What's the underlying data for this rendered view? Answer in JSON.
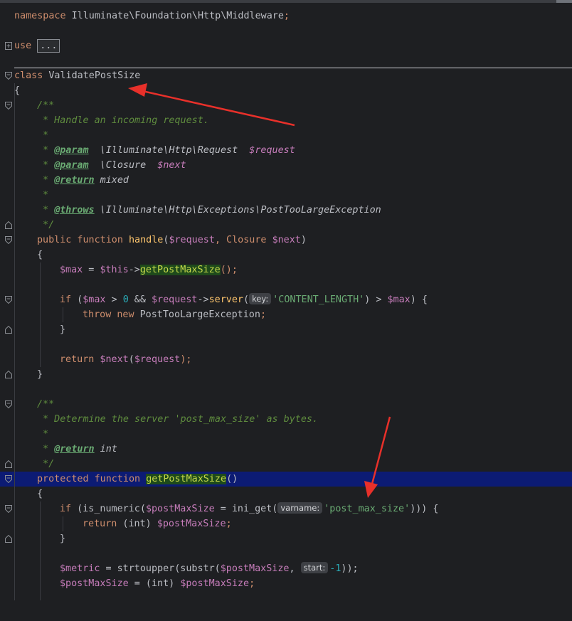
{
  "editor": {
    "lines": {
      "namespace_kw": "namespace",
      "namespace_name": " Illuminate\\Foundation\\Http\\Middleware",
      "namespace_semi": ";",
      "use_kw": "use",
      "use_folded": "...",
      "class_kw": "class",
      "class_name": " ValidatePostSize",
      "brace_open": "{",
      "doc1_open": "/**",
      "doc1_line1": " * Handle an incoming request.",
      "doc1_star": " *",
      "doc1_param1_star": " * ",
      "doc1_param1_tag": "@param",
      "doc1_param1_type": "  \\Illuminate\\Http\\Request  ",
      "doc1_param1_var": "$request",
      "doc1_param2_tag": "@param",
      "doc1_param2_type": "  \\Closure  ",
      "doc1_param2_var": "$next",
      "doc1_return_tag": "@return",
      "doc1_return_type": " mixed",
      "doc1_throws_tag": "@throws",
      "doc1_throws_type": " \\Illuminate\\Http\\Exceptions\\PostTooLargeException",
      "doc1_close": " */",
      "handle_public": "public",
      "handle_function": " function ",
      "handle_name": "handle",
      "handle_paren_open": "(",
      "handle_req": "$request",
      "handle_comma": ", Closure ",
      "handle_next": "$next",
      "handle_paren_close": ")",
      "body_brace_open": "{",
      "max_var": "$max",
      "max_eq": " = ",
      "this_var": "$this",
      "arrow_op": "->",
      "getpms_call": "getPostMaxSize",
      "call_end": "();",
      "if_kw": "if",
      "if_open": " (",
      "if_max": "$max",
      "if_gt": " > ",
      "if_zero": "0",
      "if_and": " && ",
      "if_req": "$request",
      "if_arrow": "->",
      "if_server": "server",
      "if_paren": "(",
      "hint_key": "key:",
      "if_str": "'CONTENT_LENGTH'",
      "if_close1": ") > ",
      "if_max2": "$max",
      "if_close2": ") {",
      "throw_kw": "throw",
      "new_kw": " new",
      "throw_cls": " PostTooLargeException",
      "throw_semi": ";",
      "if_brace_close": "}",
      "return_kw": "return",
      "return_next": " $next",
      "return_paren": "(",
      "return_req": "$request",
      "return_end": ");",
      "body_brace_close": "}",
      "doc2_open": "/**",
      "doc2_line1": " * Determine the server 'post_max_size' as bytes.",
      "doc2_star": " *",
      "doc2_return_tag": "@return",
      "doc2_return_type": " int",
      "doc2_close": " */",
      "gpms_protected": "protected",
      "gpms_function": " function ",
      "gpms_name": "getPostMaxSize",
      "gpms_parens": "()",
      "gpms_brace_open": "{",
      "if2_kw": "if",
      "if2_open": " (is_numeric(",
      "if2_var": "$postMaxSize",
      "if2_eq": " = ini_get(",
      "hint_varname": "varname:",
      "if2_str": "'post_max_size'",
      "if2_close": "))) {",
      "ret2_kw": "return",
      "ret2_cast": " (int) ",
      "ret2_var": "$postMaxSize",
      "ret2_semi": ";",
      "if2_brace_close": "}",
      "metric_var": "$metric",
      "metric_eq": " = strtoupper(substr(",
      "metric_pms": "$postMaxSize",
      "metric_comma": ", ",
      "hint_start": "start:",
      "metric_num": "-1",
      "metric_end": "));",
      "pms_var": "$postMaxSize",
      "pms_eq": " = (int) ",
      "pms_var2": "$postMaxSize",
      "pms_semi": ";"
    }
  },
  "colors": {
    "background": "#1e1f22",
    "current_line": "#0c1b74",
    "keyword": "#cf8e6d",
    "string": "#6aab73",
    "variable": "#c77dbb",
    "doc_comment": "#5f8c3e",
    "annotation_arrow": "#e8302a"
  }
}
